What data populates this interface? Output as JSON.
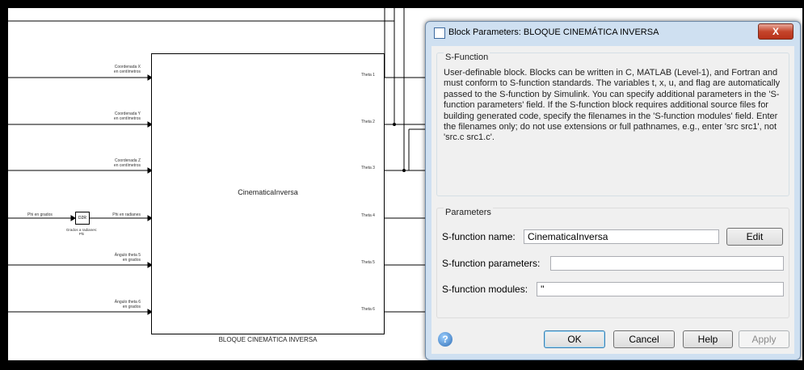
{
  "model": {
    "inputs": [
      {
        "label": "Coordenada X\nen centímetros"
      },
      {
        "label": "Coordenada Y\nen centímetros"
      },
      {
        "label": "Coordenada Z\nen centímetros"
      },
      {
        "label": "Phi en radianes"
      },
      {
        "label": "Ángulo theta 5\nen grados"
      },
      {
        "label": "Ángulo theta 6\nen grados"
      }
    ],
    "outputs": [
      "Theta 1",
      "Theta 2",
      "Theta 3",
      "Theta 4",
      "Theta 5",
      "Theta 6"
    ],
    "phi_source_label": "Phi en grados",
    "d2r_block_label": "D2R",
    "d2r_caption": "Grados a radianes:\nPhi",
    "block_name": "CinematicaInversa",
    "block_caption": "BLOQUE CINEMÁTICA INVERSA"
  },
  "dialog": {
    "title": "Block Parameters: BLOQUE CINEMÁTICA INVERSA",
    "close_label": "X",
    "sfunction_group_title": "S-Function",
    "description": "User-definable block.  Blocks can be written in C, MATLAB (Level-1), and Fortran and must conform to S-function standards.  The variables t, x, u, and flag are automatically passed to the S-function by Simulink.  You can specify additional parameters in the 'S-function parameters' field. If the S-function block requires additional source files for building generated code, specify the filenames in the 'S-function modules' field. Enter the filenames only; do not use extensions or full pathnames, e.g., enter 'src src1', not 'src.c src1.c'.",
    "parameters_group_title": "Parameters",
    "name_label": "S-function name:",
    "name_value": "CinematicaInversa",
    "edit_label": "Edit",
    "params_label": "S-function parameters:",
    "params_value": "",
    "modules_label": "S-function modules:",
    "modules_value": "''",
    "ok_label": "OK",
    "cancel_label": "Cancel",
    "help_label": "Help",
    "apply_label": "Apply"
  }
}
